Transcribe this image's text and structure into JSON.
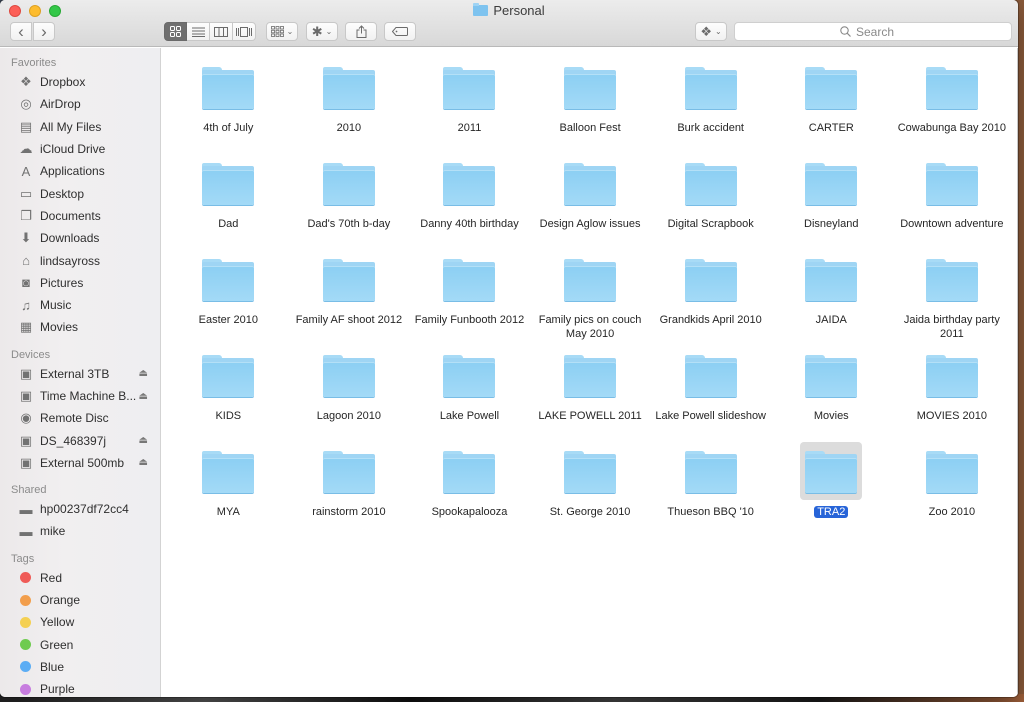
{
  "window": {
    "title": "Personal"
  },
  "toolbar": {
    "back_icon": "‹",
    "forward_icon": "›",
    "view_modes": [
      {
        "name": "icon-view",
        "glyph": "▦",
        "active": true
      },
      {
        "name": "list-view",
        "glyph": "≡",
        "active": false
      },
      {
        "name": "column-view",
        "glyph": "▥",
        "active": false
      },
      {
        "name": "cover-flow-view",
        "glyph": "▭",
        "active": false
      }
    ],
    "arrange_glyph": "▦",
    "action_glyph": "✱",
    "share_glyph": "⇪",
    "tag_glyph": "⬭",
    "dropbox_glyph": "❖",
    "chevron": "⌄",
    "search_placeholder": "Search",
    "search_icon": "⌕"
  },
  "sidebar": {
    "sections": [
      {
        "title": "Favorites",
        "items": [
          {
            "label": "Dropbox",
            "icon": "dropbox-icon",
            "glyph": "❖"
          },
          {
            "label": "AirDrop",
            "icon": "airdrop-icon",
            "glyph": "◎"
          },
          {
            "label": "All My Files",
            "icon": "all-files-icon",
            "glyph": "▤"
          },
          {
            "label": "iCloud Drive",
            "icon": "cloud-icon",
            "glyph": "☁"
          },
          {
            "label": "Applications",
            "icon": "applications-icon",
            "glyph": "A"
          },
          {
            "label": "Desktop",
            "icon": "desktop-icon",
            "glyph": "▭"
          },
          {
            "label": "Documents",
            "icon": "documents-icon",
            "glyph": "❐"
          },
          {
            "label": "Downloads",
            "icon": "downloads-icon",
            "glyph": "⬇"
          },
          {
            "label": "lindsayross",
            "icon": "home-icon",
            "glyph": "⌂"
          },
          {
            "label": "Pictures",
            "icon": "camera-icon",
            "glyph": "◙"
          },
          {
            "label": "Music",
            "icon": "music-note-icon",
            "glyph": "♫"
          },
          {
            "label": "Movies",
            "icon": "film-icon",
            "glyph": "▦"
          }
        ]
      },
      {
        "title": "Devices",
        "items": [
          {
            "label": "External 3TB",
            "icon": "hard-drive-icon",
            "glyph": "▣",
            "eject": true
          },
          {
            "label": "Time Machine B...",
            "icon": "hard-drive-icon",
            "glyph": "▣",
            "eject": true
          },
          {
            "label": "Remote Disc",
            "icon": "disc-icon",
            "glyph": "◉",
            "eject": false
          },
          {
            "label": "DS_468397j",
            "icon": "hard-drive-icon",
            "glyph": "▣",
            "eject": true
          },
          {
            "label": "External 500mb",
            "icon": "hard-drive-icon",
            "glyph": "▣",
            "eject": true
          }
        ]
      },
      {
        "title": "Shared",
        "items": [
          {
            "label": "hp00237df72cc4",
            "icon": "computer-icon",
            "glyph": "▬"
          },
          {
            "label": "mike",
            "icon": "computer-icon",
            "glyph": "▬"
          }
        ]
      },
      {
        "title": "Tags",
        "items": [
          {
            "label": "Red",
            "color": "#ef5b57"
          },
          {
            "label": "Orange",
            "color": "#f29e4c"
          },
          {
            "label": "Yellow",
            "color": "#f4d052"
          },
          {
            "label": "Green",
            "color": "#6fcb4f"
          },
          {
            "label": "Blue",
            "color": "#5cadf4"
          },
          {
            "label": "Purple",
            "color": "#c77ddf"
          }
        ]
      }
    ],
    "eject_glyph": "⏏"
  },
  "folders": [
    {
      "name": "4th of July"
    },
    {
      "name": "2010"
    },
    {
      "name": "2011"
    },
    {
      "name": "Balloon Fest"
    },
    {
      "name": "Burk accident"
    },
    {
      "name": "CARTER"
    },
    {
      "name": "Cowabunga Bay 2010"
    },
    {
      "name": "Dad"
    },
    {
      "name": "Dad's 70th b-day"
    },
    {
      "name": "Danny 40th birthday"
    },
    {
      "name": "Design Aglow issues"
    },
    {
      "name": "Digital Scrapbook"
    },
    {
      "name": "Disneyland"
    },
    {
      "name": "Downtown adventure"
    },
    {
      "name": "Easter 2010"
    },
    {
      "name": "Family AF shoot 2012"
    },
    {
      "name": "Family Funbooth 2012"
    },
    {
      "name": "Family pics on couch May 2010"
    },
    {
      "name": "Grandkids April 2010"
    },
    {
      "name": "JAIDA"
    },
    {
      "name": "Jaida birthday party 2011"
    },
    {
      "name": "KIDS"
    },
    {
      "name": "Lagoon 2010"
    },
    {
      "name": "Lake Powell"
    },
    {
      "name": "LAKE POWELL 2011"
    },
    {
      "name": "Lake Powell slideshow"
    },
    {
      "name": "Movies"
    },
    {
      "name": "MOVIES 2010"
    },
    {
      "name": "MYA"
    },
    {
      "name": "rainstorm 2010"
    },
    {
      "name": "Spookapalooza"
    },
    {
      "name": "St. George 2010"
    },
    {
      "name": "Thueson BBQ '10"
    },
    {
      "name": "TRA2",
      "selected": true
    },
    {
      "name": "Zoo 2010"
    }
  ],
  "colors": {
    "selection": "#2764d8",
    "folder": "#9fd5f4"
  }
}
